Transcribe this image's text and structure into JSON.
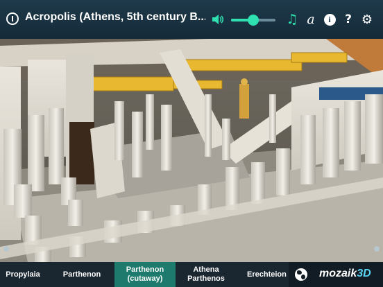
{
  "header": {
    "title": "Acropolis (Athens, 5th century B...",
    "volume_percent": 50
  },
  "tabs": [
    {
      "label": "Propylaia"
    },
    {
      "label": "Parthenon"
    },
    {
      "label": "Parthenon\n(cutaway)",
      "active": true
    },
    {
      "label": "Athena\nParthenos"
    },
    {
      "label": "Erechteion"
    }
  ],
  "brand": {
    "name": "mozaik",
    "suffix": "3D"
  },
  "icons": {
    "info": "info-circle-icon",
    "volume": "speaker-icon",
    "music": "music-note-icon",
    "font": "font-a-icon",
    "details": "info-filled-icon",
    "help": "question-mark-icon",
    "settings": "gear-icon",
    "globe": "globe-icon"
  },
  "colors": {
    "accent": "#2fe0b0",
    "active_tab": "#1e7a6d",
    "brand_3d": "#5ad4f2"
  }
}
